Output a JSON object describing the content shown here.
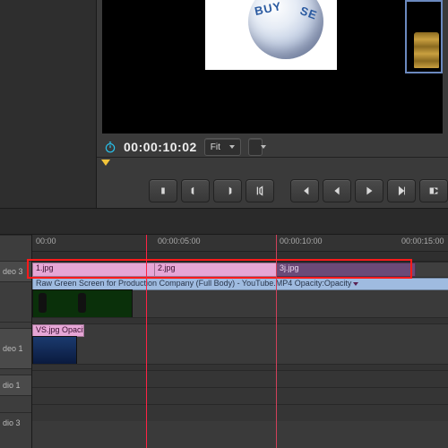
{
  "monitor": {
    "globe_text_1": "BUY",
    "globe_text_2": "SE"
  },
  "timecode": {
    "current": "00:00:10:02"
  },
  "fit_select": {
    "label": "Fit"
  },
  "ruler": {
    "t0": "00:00",
    "t1": "00:00:05:00",
    "t2": "00:00:10:00",
    "t3": "00:00:15:00"
  },
  "track_labels": {
    "video3": "deo 3",
    "video1": "deo 1",
    "audio1": "dio 1",
    "audio3": "dio 3"
  },
  "clips": {
    "v3_a": "1.jpg",
    "v3_b": "2.jpg",
    "v3_c": "3j.jpg",
    "v2_a": "Raw Green Screen for Production Company (Full Body) - YouTube.MP4  Opacity:Opacity",
    "v1_a": "VS.jpg  Opacity:Opacity"
  }
}
